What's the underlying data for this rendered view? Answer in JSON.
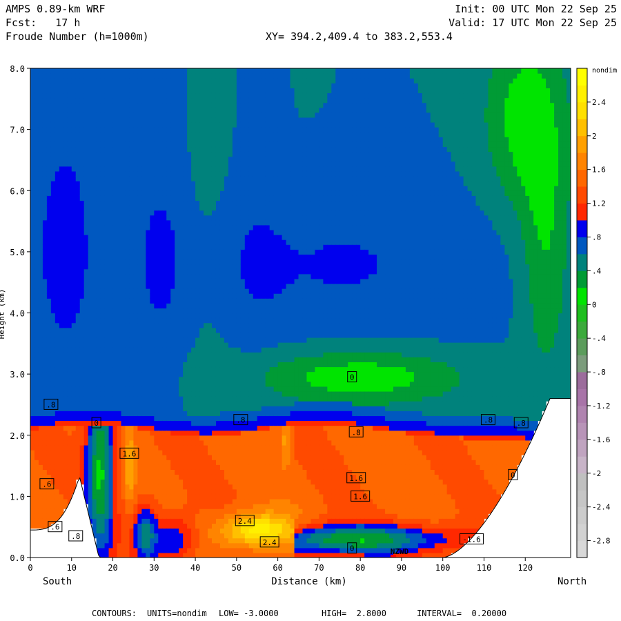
{
  "header": {
    "model": "AMPS 0.89-km WRF",
    "forecast": "Fcst:   17 h",
    "field": "Froude Number (h=1000m)",
    "init": "Init: 00 UTC Mon 22 Sep 25",
    "valid": "Valid: 17 UTC Mon 22 Sep 25",
    "xy": "XY= 394.2,409.4 to 383.2,553.4"
  },
  "footer": {
    "contours_label": "CONTOURS:",
    "units": "UNITS=nondim",
    "low": "LOW= -3.0000",
    "high": "HIGH=  2.8000",
    "interval": "INTERVAL=  0.20000"
  },
  "chart_data": {
    "type": "heatmap",
    "title": "Froude Number (h=1000m)",
    "xlabel": "Distance (km)",
    "ylabel": "Height (km)",
    "xlim": [
      0,
      131
    ],
    "ylim": [
      0,
      8
    ],
    "x_ticks": [
      0,
      10,
      20,
      30,
      40,
      50,
      60,
      70,
      80,
      90,
      100,
      110,
      120
    ],
    "y_ticks": [
      0.0,
      1.0,
      2.0,
      3.0,
      4.0,
      5.0,
      6.0,
      7.0,
      8.0
    ],
    "y_tick_labels": [
      "0.0",
      "1.0",
      "2.0",
      "3.0",
      "4.0",
      "5.0",
      "6.0",
      "7.0",
      "8.0"
    ],
    "x_end_labels": {
      "left": "South",
      "right": "North"
    },
    "site_label": {
      "text": "NZWD",
      "x": 88
    },
    "colorbar": {
      "units": "nondim",
      "boundaries": [
        -3.0,
        -2.8,
        -2.6,
        -2.4,
        -2.2,
        -2.0,
        -1.8,
        -1.6,
        -1.4,
        -1.2,
        -1.0,
        -0.8,
        -0.6,
        -0.4,
        -0.2,
        0.0,
        0.2,
        0.4,
        0.6,
        0.8,
        1.0,
        1.2,
        1.4,
        1.6,
        1.8,
        2.0,
        2.2,
        2.4,
        2.6,
        2.8
      ],
      "tick_values": [
        -2.8,
        -2.4,
        -2.0,
        -1.6,
        -1.2,
        -0.8,
        -0.4,
        0.0,
        0.4,
        0.8,
        1.2,
        1.6,
        2.0,
        2.4
      ],
      "tick_labels": [
        "-2.8",
        "-2.4",
        "-2",
        "-1.6",
        "-1.2",
        "-.8",
        "-.4",
        "0",
        ".4",
        ".8",
        "1.2",
        "1.6",
        "2",
        "2.4"
      ],
      "colors": [
        "#d8d8d8",
        "#d2d2d2",
        "#cccccc",
        "#c6c6c6",
        "#c0c0c0",
        "#c8b4c8",
        "#c0a4c0",
        "#b894b8",
        "#b084b0",
        "#a874a8",
        "#9c6c9c",
        "#7c9c7c",
        "#5c9c5c",
        "#3caa3c",
        "#1ebe1e",
        "#00e400",
        "#009b35",
        "#00827c",
        "#0058c0",
        "#0000ee",
        "#ff2800",
        "#ff4a00",
        "#ff6800",
        "#ff8400",
        "#ffa000",
        "#ffc000",
        "#ffe000",
        "#fff000",
        "#ffff00"
      ]
    },
    "contour_labels": [
      {
        "text": ".8",
        "x": 5,
        "y": 2.5
      },
      {
        "text": ".6",
        "x": 4,
        "y": 1.2
      },
      {
        "text": ".6",
        "x": 6,
        "y": 0.5
      },
      {
        "text": ".8",
        "x": 11,
        "y": 0.35
      },
      {
        "text": "0",
        "x": 16,
        "y": 2.2
      },
      {
        "text": "1.6",
        "x": 24,
        "y": 1.7
      },
      {
        "text": "1.6",
        "x": 79,
        "y": 1.3
      },
      {
        "text": "1.6",
        "x": 80,
        "y": 1.0
      },
      {
        "text": "2.4",
        "x": 52,
        "y": 0.6
      },
      {
        "text": "2.4",
        "x": 58,
        "y": 0.25
      },
      {
        "text": ".8",
        "x": 51,
        "y": 2.25
      },
      {
        "text": ".8",
        "x": 79,
        "y": 2.05
      },
      {
        "text": ".8",
        "x": 111,
        "y": 2.25
      },
      {
        "text": ".8",
        "x": 119,
        "y": 2.2
      },
      {
        "text": "0",
        "x": 78,
        "y": 2.95
      },
      {
        "text": "0",
        "x": 78,
        "y": 0.15
      },
      {
        "text": "0",
        "x": 117,
        "y": 1.35
      },
      {
        "text": "-1.6",
        "x": 107,
        "y": 0.3
      }
    ]
  }
}
